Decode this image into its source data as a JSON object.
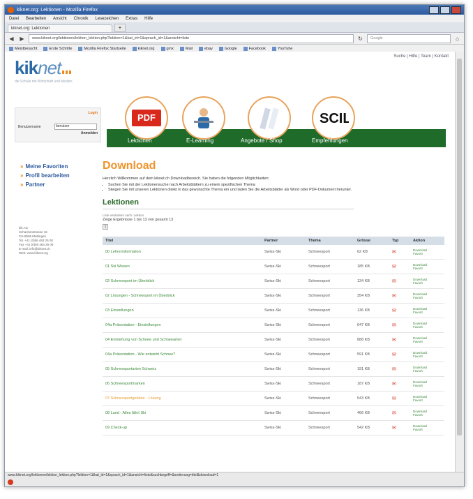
{
  "browser": {
    "window_title": "kiknet.org: Lektionen - Mozilla Firefox",
    "menu": [
      "Datei",
      "Bearbeiten",
      "Ansicht",
      "Chronik",
      "Lesezeichen",
      "Extras",
      "Hilfe"
    ],
    "tab_label": "kiknet.org: Lektionen",
    "url": "www.kiknet.org/lektionen/lektion_lektion.php?lektion=1&kat_id=1&sprach_id=1&ansicht=liste",
    "search_placeholder": "Google",
    "bookmarks": [
      "Meistbesucht",
      "Erste Schritte",
      "Mozilla Firefox Startseite",
      "kiknet.org",
      "gmx",
      "Mail",
      "ebay",
      "Google",
      "Facebook",
      "YouTube"
    ],
    "status_url": "www.kiknet.org/lektionen/lektion_lektion.php?lektion=1&kat_id=1&sprach_id=1&ansicht=liste&suchbegriff=&sortierung=titel&download=1"
  },
  "site": {
    "logo_main": "kik",
    "logo_net": "net",
    "tagline": "die Schule mit Wirtschaft und Medien",
    "top_links": "Suche | Hilfe | Team | Kontakt",
    "login_title": "Login",
    "login_label": "Benutzername",
    "login_value": "benutzer",
    "login_button": "Anmelden"
  },
  "nav": {
    "items": [
      {
        "label": "Lektionen"
      },
      {
        "label": "E-Learning"
      },
      {
        "label": "Angebote / Shop"
      },
      {
        "label": "Empfehlungen"
      }
    ]
  },
  "sidebar": {
    "items": [
      {
        "label": "Meine Favoriten"
      },
      {
        "label": "Profil bearbeiten"
      },
      {
        "label": "Partner"
      }
    ],
    "address_lines": [
      "kik AG",
      "Schachenstrasse 18",
      "CH-8506 Mattingen",
      "Tel. +41 (0)56 483 25 00",
      "Fax +41 (0)56 483 25 09",
      "E-mail: info@kiknet.ch",
      "Web: www.kiknet.org"
    ]
  },
  "main": {
    "title": "Download",
    "intro": "Herzlich Willkommen auf dem kiknet.ch Downloadbereich. Sie haben die folgenden Möglichkeiten:",
    "bullets": [
      "Suchen Sie mit der Lektionensuche nach Arbeitsblättern zu einem spezifischen Thema",
      "Steigen Sie mit unseren Lektionen direkt in das gewünschte Thema ein und laden Sie die Arbeitsblätter als Word oder PDF-Dokument herunter."
    ],
    "section_title": "Lektionen",
    "sort_label": "Liste verändern nach: Lektion",
    "result_count": "Zeige Ergebnisse 1 bis 13 von gesamt 13",
    "page_number": "1",
    "columns": [
      "Titel",
      "Partner",
      "Thema",
      "Grösse",
      "Typ",
      "Aktion"
    ],
    "rows": [
      {
        "title": "00 Lehrerinformation",
        "partner": "Swiss-Ski",
        "theme": "Schneesport",
        "size": "62 KB",
        "highlight": false
      },
      {
        "title": "01 Ski Wissen",
        "partner": "Swiss-Ski",
        "theme": "Schneesport",
        "size": "185 KB",
        "highlight": false
      },
      {
        "title": "02 Schneesport im Überblick",
        "partner": "Swiss-Ski",
        "theme": "Schneesport",
        "size": "134 KB",
        "highlight": false
      },
      {
        "title": "02 Lösungen - Schneesport im Überblick",
        "partner": "Swiss-Ski",
        "theme": "Schneesport",
        "size": "354 KB",
        "highlight": false
      },
      {
        "title": "03 Einstellungen",
        "partner": "Swiss-Ski",
        "theme": "Schneesport",
        "size": "136 KB",
        "highlight": false
      },
      {
        "title": "04a Präsentation - Einstellungen",
        "partner": "Swiss-Ski",
        "theme": "Schneesport",
        "size": "647 KB",
        "highlight": false
      },
      {
        "title": "04 Entstehung von Schnee und Schneearten",
        "partner": "Swiss-Ski",
        "theme": "Schneesport",
        "size": "888 KB",
        "highlight": false
      },
      {
        "title": "04a Präsentation - Wie entsteht Schnee?",
        "partner": "Swiss-Ski",
        "theme": "Schneesport",
        "size": "591 KB",
        "highlight": false
      },
      {
        "title": "05 Schneesportarten Schweiz",
        "partner": "Swiss-Ski",
        "theme": "Schneesport",
        "size": "191 KB",
        "highlight": false
      },
      {
        "title": "06 Schneesportmarken",
        "partner": "Swiss-Ski",
        "theme": "Schneesport",
        "size": "187 KB",
        "highlight": false
      },
      {
        "title": "07 Schneesportgebiete - Lösung",
        "partner": "Swiss-Ski",
        "theme": "Schneesport",
        "size": "543 KB",
        "highlight": true
      },
      {
        "title": "08 Lund - Alles fährt Ski",
        "partner": "Swiss-Ski",
        "theme": "Schneesport",
        "size": "466 KB",
        "highlight": false
      },
      {
        "title": "09 Check-up",
        "partner": "Swiss-Ski",
        "theme": "Schneesport",
        "size": "542 KB",
        "highlight": false
      }
    ],
    "action_download": "Download",
    "action_favorite": "Favorit"
  },
  "colors": {
    "brand_blue": "#2b6aa6",
    "accent_orange": "#f0932b",
    "nav_green": "#1e6b2a",
    "link_green": "#3a8a3a"
  }
}
